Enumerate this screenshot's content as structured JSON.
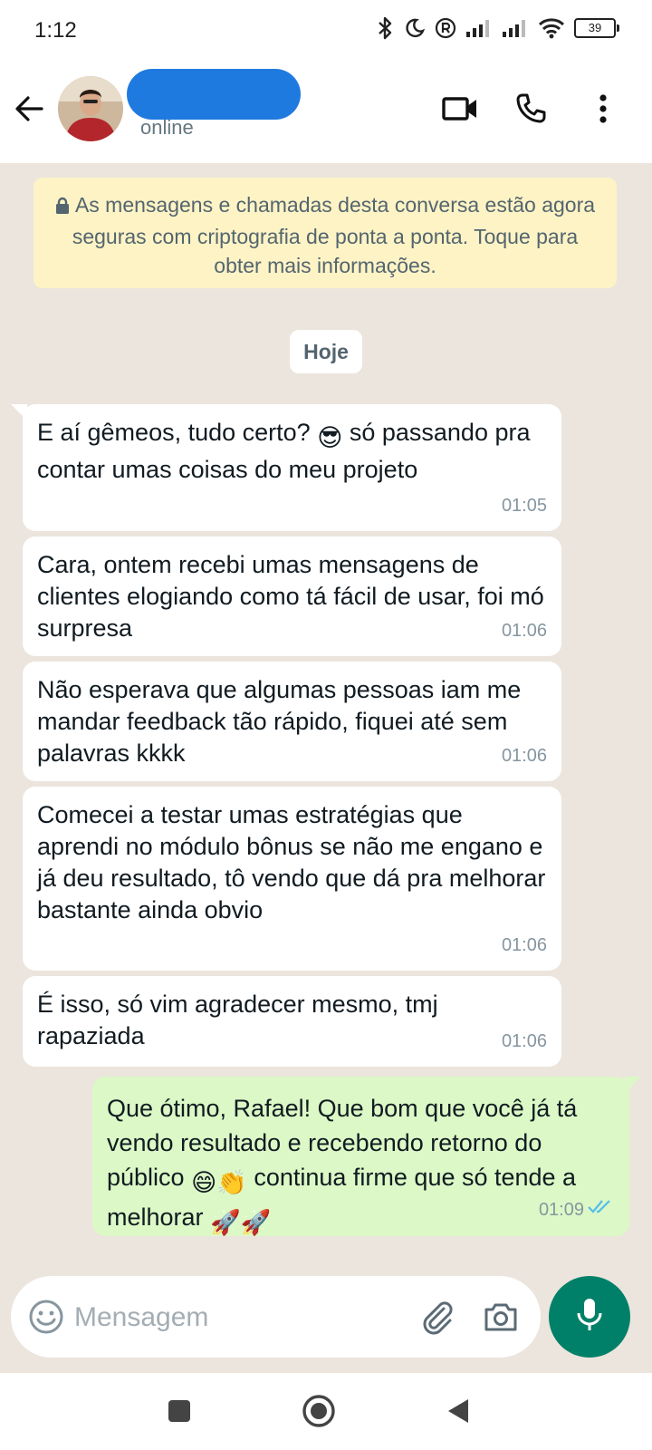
{
  "status_bar": {
    "time": "1:12",
    "battery": "39",
    "icons": [
      "bluetooth-icon",
      "do-not-disturb-moon-icon",
      "registered-icon",
      "signal-icon",
      "signal-icon",
      "wifi-icon",
      "battery-icon"
    ]
  },
  "header": {
    "status": "online",
    "icons": [
      "back-arrow-icon",
      "video-call-icon",
      "phone-icon",
      "more-options-icon"
    ]
  },
  "encryption_notice": {
    "text": "As mensagens e chamadas desta conversa estão agora seguras com criptografia de ponta a ponta. Toque para obter mais informações."
  },
  "date_chip": "Hoje",
  "messages": [
    {
      "direction": "incoming",
      "text_before": "E aí gêmeos, tudo certo? ",
      "emoji": "😎",
      "text_after": " só passando pra contar umas coisas do meu projeto",
      "time": "01:05"
    },
    {
      "direction": "incoming",
      "text": "Cara, ontem recebi umas mensagens de clientes elogiando como tá fácil de usar, foi mó surpresa",
      "time": "01:06"
    },
    {
      "direction": "incoming",
      "text": "Não esperava que algumas pessoas iam me mandar feedback tão rápido, fiquei até sem palavras kkkk",
      "time": "01:06"
    },
    {
      "direction": "incoming",
      "text": "Comecei a testar umas estratégias que aprendi no módulo bônus se não me engano e já deu resultado, tô vendo que dá pra melhorar bastante ainda obvio",
      "time": "01:06"
    },
    {
      "direction": "incoming",
      "text": "É isso, só vim agradecer mesmo, tmj rapaziada",
      "time": "01:06"
    },
    {
      "direction": "outgoing",
      "text_a": "Que ótimo, Rafael! Que bom que você já tá vendo resultado e recebendo retorno do público ",
      "emoji_a": "😄👏",
      "text_b": " continua firme que só tende a melhorar ",
      "emoji_b": "🚀🚀",
      "time": "01:09",
      "status": "read"
    }
  ],
  "composer": {
    "placeholder": "Mensagem",
    "icons": [
      "emoji-icon",
      "attach-icon",
      "camera-icon",
      "mic-icon"
    ]
  },
  "nav_bar": {
    "icons": [
      "recent-apps-icon",
      "home-icon",
      "back-triangle-icon"
    ]
  },
  "colors": {
    "chat_background": "#ece5dd",
    "incoming_bubble": "#ffffff",
    "outgoing_bubble": "#dcf8c6",
    "notice_background": "#fdf3c5",
    "accent": "#008069",
    "read_ticks": "#53bdeb",
    "redaction": "#1f7ae0"
  }
}
